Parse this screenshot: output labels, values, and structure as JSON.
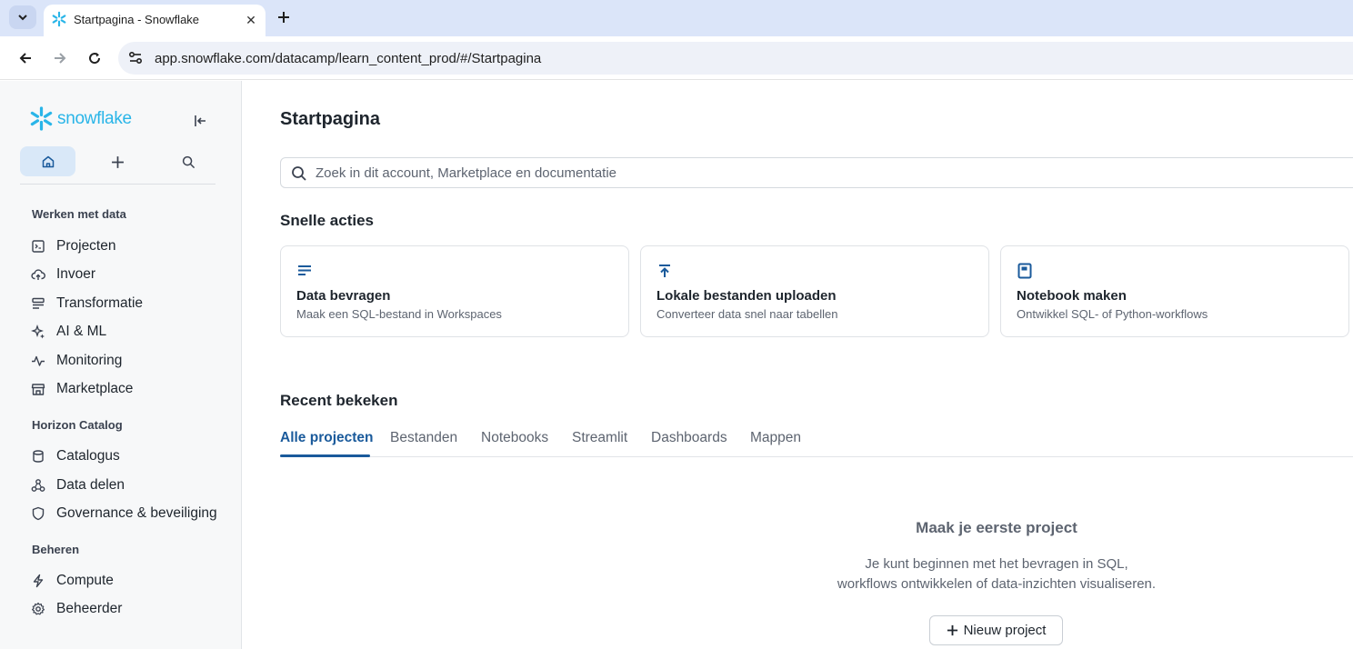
{
  "browser": {
    "tab_title": "Startpagina - Snowflake",
    "tab_close": "✕",
    "url": "app.snowflake.com/datacamp/learn_content_prod/#/Startpagina"
  },
  "sidebar": {
    "logo_text": "snowflake",
    "sections": [
      {
        "title": "Werken met data",
        "items": [
          {
            "label": "Projecten",
            "icon": "projects-icon"
          },
          {
            "label": "Invoer",
            "icon": "upload-cloud-icon"
          },
          {
            "label": "Transformatie",
            "icon": "transform-icon"
          },
          {
            "label": "AI & ML",
            "icon": "sparkle-icon"
          },
          {
            "label": "Monitoring",
            "icon": "activity-icon"
          },
          {
            "label": "Marketplace",
            "icon": "store-icon"
          }
        ]
      },
      {
        "title": "Horizon Catalog",
        "items": [
          {
            "label": "Catalogus",
            "icon": "database-icon"
          },
          {
            "label": "Data delen",
            "icon": "share-icon"
          },
          {
            "label": "Governance & beveiliging",
            "icon": "shield-icon"
          }
        ]
      },
      {
        "title": "Beheren",
        "items": [
          {
            "label": "Compute",
            "icon": "bolt-icon"
          },
          {
            "label": "Beheerder",
            "icon": "gear-icon"
          }
        ]
      }
    ]
  },
  "main": {
    "title": "Startpagina",
    "search_placeholder": "Zoek in dit account, Marketplace en documentatie",
    "quick_actions_title": "Snelle acties",
    "quick_actions": [
      {
        "title": "Data bevragen",
        "desc": "Maak een SQL-bestand in Workspaces",
        "icon": "lines-icon"
      },
      {
        "title": "Lokale bestanden uploaden",
        "desc": "Converteer data snel naar tabellen",
        "icon": "upload-arrow-icon"
      },
      {
        "title": "Notebook maken",
        "desc": "Ontwikkel SQL- of Python-workflows",
        "icon": "notebook-icon"
      }
    ],
    "recent_title": "Recent bekeken",
    "tabs": [
      "Alle projecten",
      "Bestanden",
      "Notebooks",
      "Streamlit",
      "Dashboards",
      "Mappen"
    ],
    "empty_title": "Maak je eerste project",
    "empty_line1": "Je kunt beginnen met het bevragen in SQL,",
    "empty_line2": "workflows ontwikkelen of data-inzichten visualiseren.",
    "new_project_label": "Nieuw project"
  },
  "colors": {
    "accent": "#1a5a9b",
    "brand": "#29b5e8",
    "sidebar_bg": "#f7f8f9"
  }
}
